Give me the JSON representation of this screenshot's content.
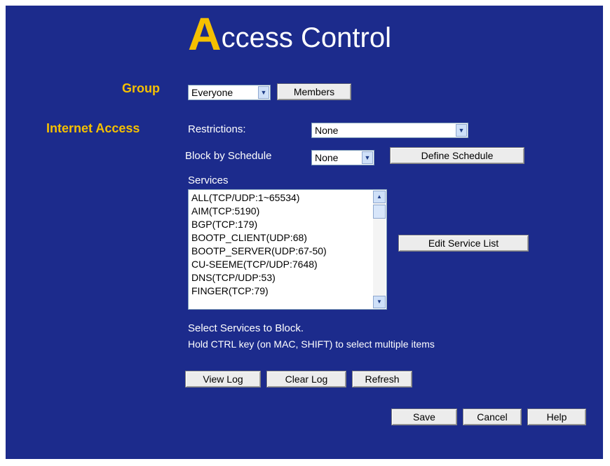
{
  "title": {
    "initial": "A",
    "rest": "ccess Control"
  },
  "group": {
    "label": "Group",
    "select_value": "Everyone",
    "members_button": "Members"
  },
  "internet_access": {
    "label": "Internet Access",
    "restrictions_label": "Restrictions:",
    "restrictions_value": "None",
    "block_schedule_label": "Block by Schedule",
    "block_schedule_value": "None",
    "define_schedule_button": "Define Schedule"
  },
  "services": {
    "label": "Services",
    "items": [
      "ALL(TCP/UDP:1~65534)",
      "AIM(TCP:5190)",
      "BGP(TCP:179)",
      "BOOTP_CLIENT(UDP:68)",
      "BOOTP_SERVER(UDP:67-50)",
      "CU-SEEME(TCP/UDP:7648)",
      "DNS(TCP/UDP:53)",
      "FINGER(TCP:79)"
    ],
    "edit_button": "Edit Service List",
    "hint_line1": "Select Services to Block.",
    "hint_line2": "Hold CTRL key (on MAC, SHIFT) to select multiple items"
  },
  "log_buttons": {
    "view": "View Log",
    "clear": "Clear Log",
    "refresh": "Refresh"
  },
  "footer_buttons": {
    "save": "Save",
    "cancel": "Cancel",
    "help": "Help"
  }
}
